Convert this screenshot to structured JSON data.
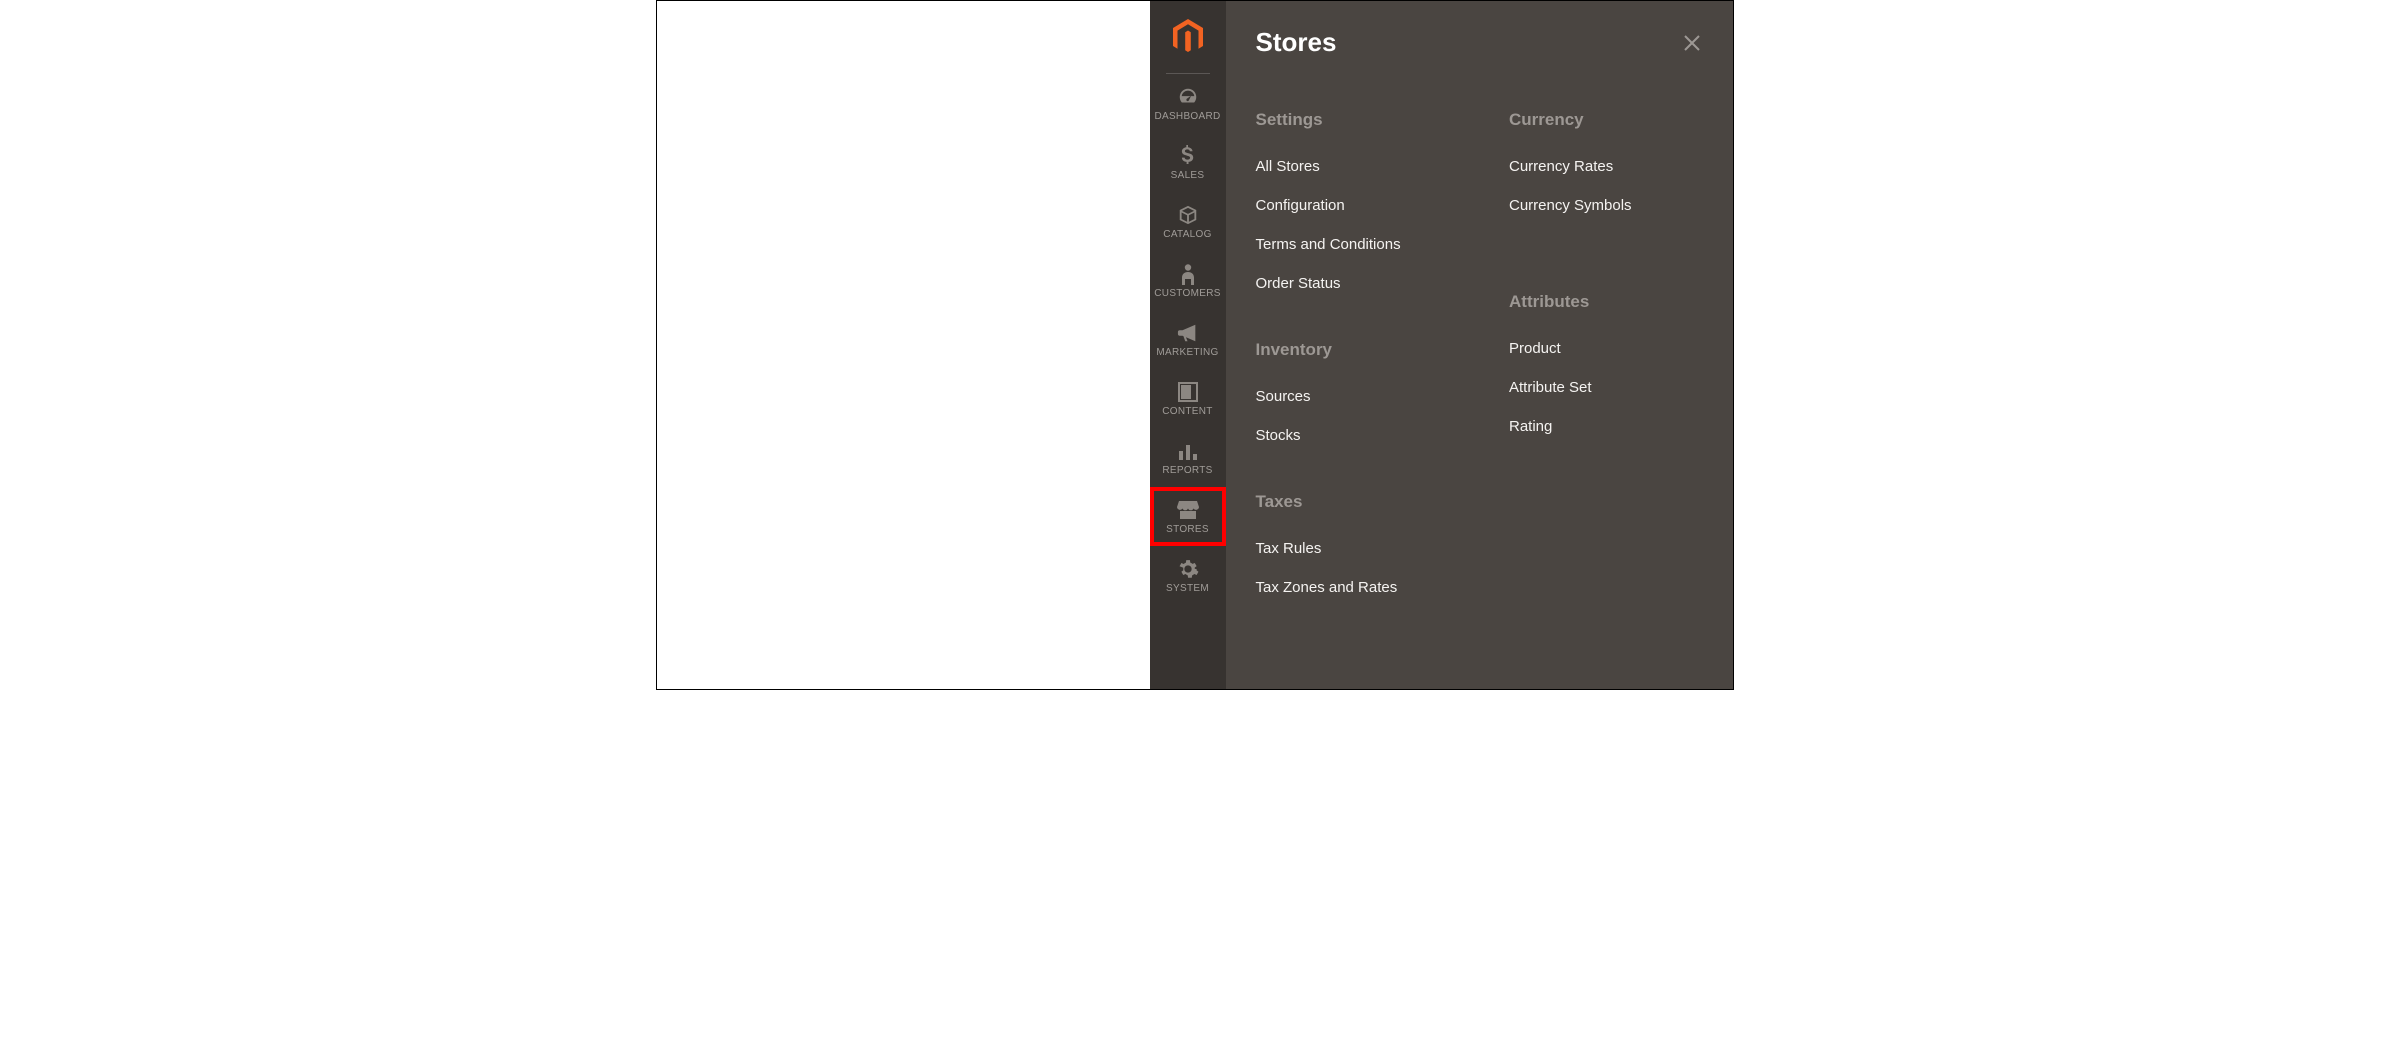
{
  "sidebar": {
    "items": [
      {
        "label": "DASHBOARD"
      },
      {
        "label": "SALES"
      },
      {
        "label": "CATALOG"
      },
      {
        "label": "CUSTOMERS"
      },
      {
        "label": "MARKETING"
      },
      {
        "label": "CONTENT"
      },
      {
        "label": "REPORTS"
      },
      {
        "label": "STORES"
      },
      {
        "label": "SYSTEM"
      }
    ]
  },
  "flyout": {
    "title": "Stores",
    "columns": [
      {
        "groups": [
          {
            "title": "Settings",
            "links": [
              "All Stores",
              "Configuration",
              "Terms and Conditions",
              "Order Status"
            ]
          },
          {
            "title": "Inventory",
            "links": [
              "Sources",
              "Stocks"
            ]
          },
          {
            "title": "Taxes",
            "links": [
              "Tax Rules",
              "Tax Zones and Rates"
            ]
          }
        ]
      },
      {
        "groups": [
          {
            "title": "Currency",
            "links": [
              "Currency Rates",
              "Currency Symbols"
            ]
          },
          {
            "title": "Attributes",
            "links": [
              "Product",
              "Attribute Set",
              "Rating"
            ]
          }
        ]
      }
    ]
  }
}
